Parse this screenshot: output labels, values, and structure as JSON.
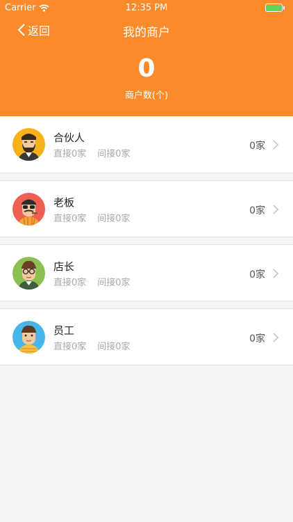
{
  "status_bar": {
    "carrier": "Carrier",
    "time": "12:35 PM"
  },
  "nav": {
    "back_label": "返回",
    "title": "我的商户"
  },
  "summary": {
    "count": "0",
    "label": "商户数(个)"
  },
  "roles": [
    {
      "name": "合伙人",
      "direct": "直接0家",
      "indirect": "间接0家",
      "total": "0家",
      "avatar": "partner-avatar"
    },
    {
      "name": "老板",
      "direct": "直接0家",
      "indirect": "间接0家",
      "total": "0家",
      "avatar": "boss-avatar"
    },
    {
      "name": "店长",
      "direct": "直接0家",
      "indirect": "间接0家",
      "total": "0家",
      "avatar": "store-manager-avatar"
    },
    {
      "name": "员工",
      "direct": "直接0家",
      "indirect": "间接0家",
      "total": "0家",
      "avatar": "employee-avatar"
    }
  ],
  "colors": {
    "header": "#fb8a2b",
    "background": "#f5f5f5"
  }
}
